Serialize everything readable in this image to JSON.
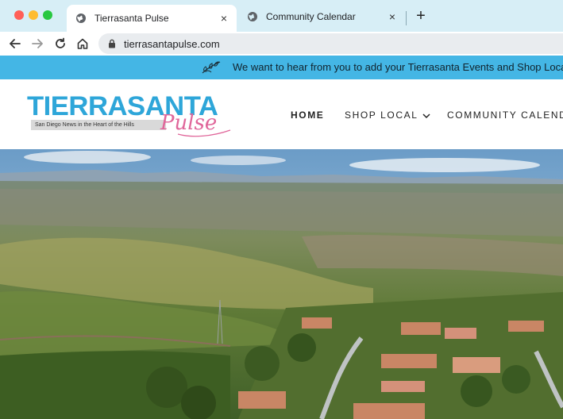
{
  "browser": {
    "tabs": [
      {
        "title": "Tierrasanta Pulse",
        "active": true
      },
      {
        "title": "Community Calendar",
        "active": false
      }
    ],
    "close_glyph": "×",
    "new_tab_glyph": "+",
    "url": "tierrasantapulse.com"
  },
  "announcement": {
    "text": "We want to hear from you to add your Tierrasanta Events and Shop Local",
    "icon": "feather-icon"
  },
  "logo": {
    "main": "TIERRASANTA",
    "script": "Pulse",
    "tagline": "San Diego News in the Heart of the Hills"
  },
  "nav": {
    "home": "HOME",
    "shop_local": "SHOP LOCAL",
    "community_calendar": "COMMUNITY CALENDAR"
  },
  "colors": {
    "tab_strip": "#d7eef6",
    "announce_bar": "#44b6e5",
    "logo_blue": "#2ea6d9",
    "logo_pink": "#e0669a"
  }
}
